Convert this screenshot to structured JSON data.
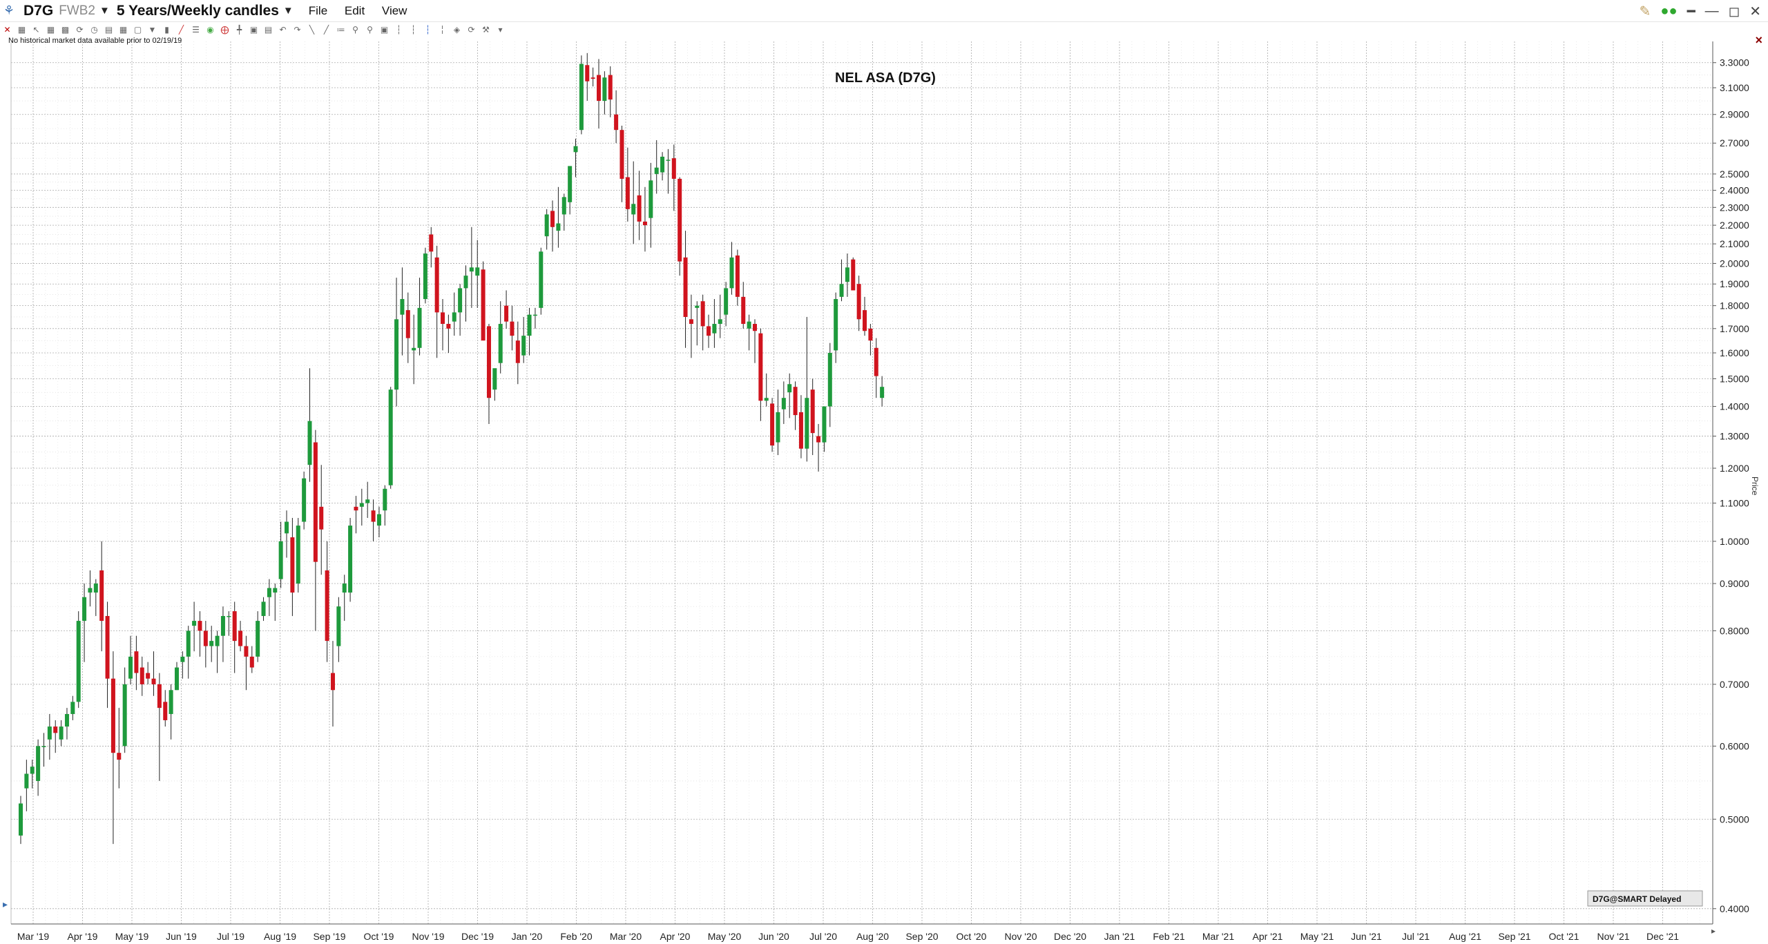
{
  "window": {
    "symbol": "D7G",
    "exchange": "FWB2",
    "period": "5 Years/Weekly candles",
    "menu": [
      "File",
      "Edit",
      "View"
    ]
  },
  "notice": "No historical market data available prior to 02/19/19",
  "source_tag": "D7G@SMART Delayed",
  "colors": {
    "up": "#1e9a3c",
    "down": "#d0141e",
    "grid": "#aaaaaa",
    "wick": "#222222"
  },
  "chart_data": {
    "type": "candlestick",
    "title": "NEL ASA (D7G)",
    "ylabel": "Price",
    "scale": "log",
    "ylim": [
      0.385,
      3.42
    ],
    "grid": true,
    "y_ticks": [
      0.4,
      0.5,
      0.6,
      0.7,
      0.8,
      0.9,
      1.0,
      1.1,
      1.2,
      1.3,
      1.4,
      1.5,
      1.6,
      1.7,
      1.8,
      1.9,
      2.0,
      2.1,
      2.2,
      2.3,
      2.4,
      2.5,
      2.7,
      2.9,
      3.1,
      3.3
    ],
    "y_tick_labels": [
      "0.4000",
      "0.5000",
      "0.6000",
      "0.7000",
      "0.8000",
      "0.9000",
      "1.0000",
      "1.1000",
      "1.2000",
      "1.3000",
      "1.4000",
      "1.5000",
      "1.6000",
      "1.7000",
      "1.8000",
      "1.9000",
      "2.0000",
      "2.1000",
      "2.2000",
      "2.3000",
      "2.4000",
      "2.5000",
      "2.7000",
      "2.9000",
      "3.1000",
      "3.3000"
    ],
    "x_labels": [
      "Mar '19",
      "Apr '19",
      "May '19",
      "Jun '19",
      "Jul '19",
      "Aug '19",
      "Sep '19",
      "Oct '19",
      "Nov '19",
      "Dec '19",
      "Jan '20",
      "Feb '20",
      "Mar '20",
      "Apr '20",
      "May '20",
      "Jun '20",
      "Jul '20",
      "Aug '20",
      "Sep '20",
      "Oct '20",
      "Nov '20",
      "Dec '20",
      "Jan '21",
      "Feb '21",
      "Mar '21",
      "Apr '21",
      "May '21",
      "Jun '21",
      "Jul '21",
      "Aug '21",
      "Sep '21",
      "Oct '21",
      "Nov '21",
      "Dec '21"
    ],
    "candles": [
      [
        0.48,
        0.53,
        0.47,
        0.52
      ],
      [
        0.54,
        0.58,
        0.51,
        0.56
      ],
      [
        0.56,
        0.58,
        0.54,
        0.57
      ],
      [
        0.55,
        0.61,
        0.53,
        0.6
      ],
      [
        0.6,
        0.62,
        0.57,
        0.6
      ],
      [
        0.61,
        0.65,
        0.58,
        0.63
      ],
      [
        0.63,
        0.64,
        0.59,
        0.62
      ],
      [
        0.61,
        0.64,
        0.6,
        0.63
      ],
      [
        0.63,
        0.66,
        0.61,
        0.65
      ],
      [
        0.65,
        0.68,
        0.64,
        0.67
      ],
      [
        0.67,
        0.84,
        0.66,
        0.82
      ],
      [
        0.82,
        0.9,
        0.74,
        0.87
      ],
      [
        0.88,
        0.93,
        0.85,
        0.89
      ],
      [
        0.88,
        0.91,
        0.83,
        0.9
      ],
      [
        0.93,
        1.0,
        0.76,
        0.82
      ],
      [
        0.83,
        0.86,
        0.66,
        0.71
      ],
      [
        0.71,
        0.76,
        0.47,
        0.59
      ],
      [
        0.59,
        0.66,
        0.54,
        0.58
      ],
      [
        0.6,
        0.73,
        0.59,
        0.7
      ],
      [
        0.71,
        0.79,
        0.7,
        0.75
      ],
      [
        0.76,
        0.79,
        0.69,
        0.72
      ],
      [
        0.73,
        0.75,
        0.68,
        0.7
      ],
      [
        0.72,
        0.74,
        0.7,
        0.71
      ],
      [
        0.71,
        0.76,
        0.68,
        0.7
      ],
      [
        0.7,
        0.72,
        0.55,
        0.66
      ],
      [
        0.67,
        0.69,
        0.63,
        0.64
      ],
      [
        0.65,
        0.7,
        0.61,
        0.69
      ],
      [
        0.69,
        0.74,
        0.69,
        0.73
      ],
      [
        0.74,
        0.76,
        0.71,
        0.75
      ],
      [
        0.75,
        0.81,
        0.71,
        0.8
      ],
      [
        0.81,
        0.86,
        0.76,
        0.82
      ],
      [
        0.82,
        0.84,
        0.75,
        0.8
      ],
      [
        0.8,
        0.82,
        0.73,
        0.77
      ],
      [
        0.77,
        0.81,
        0.74,
        0.78
      ],
      [
        0.77,
        0.8,
        0.72,
        0.79
      ],
      [
        0.79,
        0.85,
        0.74,
        0.83
      ],
      [
        0.83,
        0.84,
        0.79,
        0.83
      ],
      [
        0.84,
        0.86,
        0.72,
        0.78
      ],
      [
        0.8,
        0.82,
        0.76,
        0.77
      ],
      [
        0.77,
        0.79,
        0.69,
        0.75
      ],
      [
        0.75,
        0.77,
        0.72,
        0.73
      ],
      [
        0.75,
        0.84,
        0.74,
        0.82
      ],
      [
        0.83,
        0.87,
        0.82,
        0.86
      ],
      [
        0.87,
        0.91,
        0.83,
        0.89
      ],
      [
        0.88,
        0.9,
        0.82,
        0.89
      ],
      [
        0.91,
        1.05,
        0.89,
        1.0
      ],
      [
        1.02,
        1.08,
        0.96,
        1.05
      ],
      [
        1.01,
        1.06,
        0.83,
        0.88
      ],
      [
        0.9,
        1.06,
        0.88,
        1.04
      ],
      [
        1.05,
        1.19,
        1.03,
        1.17
      ],
      [
        1.21,
        1.54,
        1.16,
        1.35
      ],
      [
        1.28,
        1.32,
        0.8,
        0.95
      ],
      [
        1.09,
        1.21,
        0.92,
        1.03
      ],
      [
        0.93,
        1.0,
        0.74,
        0.78
      ],
      [
        0.72,
        0.78,
        0.63,
        0.69
      ],
      [
        0.77,
        0.87,
        0.74,
        0.85
      ],
      [
        0.88,
        0.92,
        0.82,
        0.9
      ],
      [
        0.88,
        1.06,
        0.86,
        1.04
      ],
      [
        1.09,
        1.12,
        1.02,
        1.08
      ],
      [
        1.09,
        1.14,
        1.04,
        1.1
      ],
      [
        1.1,
        1.16,
        1.06,
        1.11
      ],
      [
        1.08,
        1.11,
        1.0,
        1.05
      ],
      [
        1.04,
        1.09,
        1.01,
        1.07
      ],
      [
        1.08,
        1.15,
        1.04,
        1.14
      ],
      [
        1.15,
        1.47,
        1.14,
        1.46
      ],
      [
        1.46,
        1.93,
        1.4,
        1.74
      ],
      [
        1.76,
        1.98,
        1.59,
        1.83
      ],
      [
        1.78,
        1.86,
        1.56,
        1.66
      ],
      [
        1.61,
        1.76,
        1.48,
        1.62
      ],
      [
        1.62,
        1.93,
        1.59,
        1.79
      ],
      [
        1.83,
        2.08,
        1.81,
        2.05
      ],
      [
        2.15,
        2.19,
        1.98,
        2.06
      ],
      [
        2.03,
        2.09,
        1.58,
        1.77
      ],
      [
        1.77,
        1.83,
        1.61,
        1.72
      ],
      [
        1.72,
        1.76,
        1.6,
        1.7
      ],
      [
        1.73,
        1.86,
        1.67,
        1.77
      ],
      [
        1.77,
        1.9,
        1.67,
        1.88
      ],
      [
        1.88,
        1.99,
        1.73,
        1.94
      ],
      [
        1.96,
        2.19,
        1.79,
        1.98
      ],
      [
        1.94,
        2.12,
        1.79,
        1.98
      ],
      [
        1.97,
        2.01,
        1.67,
        1.65
      ],
      [
        1.71,
        1.72,
        1.34,
        1.43
      ],
      [
        1.46,
        1.49,
        1.42,
        1.54
      ],
      [
        1.56,
        1.82,
        1.52,
        1.72
      ],
      [
        1.8,
        1.87,
        1.7,
        1.73
      ],
      [
        1.73,
        1.8,
        1.61,
        1.67
      ],
      [
        1.65,
        1.73,
        1.48,
        1.56
      ],
      [
        1.59,
        1.75,
        1.56,
        1.67
      ],
      [
        1.67,
        1.79,
        1.59,
        1.76
      ],
      [
        1.76,
        1.79,
        1.7,
        1.76
      ],
      [
        1.79,
        2.08,
        1.76,
        2.06
      ],
      [
        2.14,
        2.29,
        2.07,
        2.26
      ],
      [
        2.28,
        2.34,
        2.06,
        2.19
      ],
      [
        2.17,
        2.42,
        2.08,
        2.21
      ],
      [
        2.26,
        2.38,
        2.17,
        2.36
      ],
      [
        2.33,
        2.53,
        2.26,
        2.55
      ],
      [
        2.64,
        2.73,
        2.48,
        2.68
      ],
      [
        2.79,
        3.36,
        2.76,
        3.29
      ],
      [
        3.28,
        3.38,
        3.0,
        3.15
      ],
      [
        3.18,
        3.26,
        3.11,
        3.17
      ],
      [
        3.2,
        3.33,
        2.8,
        3.0
      ],
      [
        3.0,
        3.23,
        2.9,
        3.18
      ],
      [
        3.2,
        3.27,
        2.88,
        3.01
      ],
      [
        2.9,
        3.08,
        2.7,
        2.79
      ],
      [
        2.79,
        2.82,
        2.33,
        2.47
      ],
      [
        2.48,
        2.67,
        2.22,
        2.29
      ],
      [
        2.26,
        2.58,
        2.1,
        2.32
      ],
      [
        2.37,
        2.52,
        2.12,
        2.22
      ],
      [
        2.22,
        2.42,
        2.06,
        2.2
      ],
      [
        2.24,
        2.57,
        2.08,
        2.46
      ],
      [
        2.5,
        2.72,
        2.38,
        2.54
      ],
      [
        2.51,
        2.64,
        2.46,
        2.61
      ],
      [
        2.59,
        2.66,
        2.38,
        2.59
      ],
      [
        2.6,
        2.69,
        2.28,
        2.47
      ],
      [
        2.47,
        2.48,
        1.94,
        2.01
      ],
      [
        2.03,
        2.17,
        1.62,
        1.75
      ],
      [
        1.74,
        1.85,
        1.58,
        1.72
      ],
      [
        1.79,
        1.82,
        1.63,
        1.8
      ],
      [
        1.82,
        1.85,
        1.61,
        1.71
      ],
      [
        1.71,
        1.76,
        1.62,
        1.67
      ],
      [
        1.68,
        1.83,
        1.62,
        1.72
      ],
      [
        1.72,
        1.85,
        1.66,
        1.74
      ],
      [
        1.76,
        1.91,
        1.71,
        1.88
      ],
      [
        1.88,
        2.11,
        1.85,
        2.03
      ],
      [
        2.04,
        2.07,
        1.8,
        1.84
      ],
      [
        1.84,
        1.91,
        1.7,
        1.72
      ],
      [
        1.7,
        1.76,
        1.61,
        1.73
      ],
      [
        1.72,
        1.74,
        1.56,
        1.69
      ],
      [
        1.68,
        1.7,
        1.35,
        1.42
      ],
      [
        1.42,
        1.52,
        1.4,
        1.43
      ],
      [
        1.41,
        1.43,
        1.25,
        1.27
      ],
      [
        1.28,
        1.46,
        1.24,
        1.38
      ],
      [
        1.39,
        1.49,
        1.34,
        1.43
      ],
      [
        1.45,
        1.52,
        1.36,
        1.48
      ],
      [
        1.47,
        1.49,
        1.32,
        1.37
      ],
      [
        1.38,
        1.44,
        1.23,
        1.26
      ],
      [
        1.26,
        1.75,
        1.22,
        1.43
      ],
      [
        1.46,
        1.5,
        1.24,
        1.31
      ],
      [
        1.3,
        1.34,
        1.19,
        1.28
      ],
      [
        1.28,
        1.4,
        1.25,
        1.4
      ],
      [
        1.4,
        1.64,
        1.33,
        1.6
      ],
      [
        1.61,
        1.86,
        1.56,
        1.83
      ],
      [
        1.84,
        2.02,
        1.82,
        1.9
      ],
      [
        1.91,
        2.05,
        1.84,
        1.98
      ],
      [
        2.02,
        2.03,
        1.89,
        1.87
      ],
      [
        1.9,
        1.94,
        1.69,
        1.74
      ],
      [
        1.78,
        1.84,
        1.67,
        1.69
      ],
      [
        1.7,
        1.72,
        1.59,
        1.65
      ],
      [
        1.62,
        1.66,
        1.43,
        1.51
      ],
      [
        1.43,
        1.51,
        1.4,
        1.47
      ]
    ]
  }
}
